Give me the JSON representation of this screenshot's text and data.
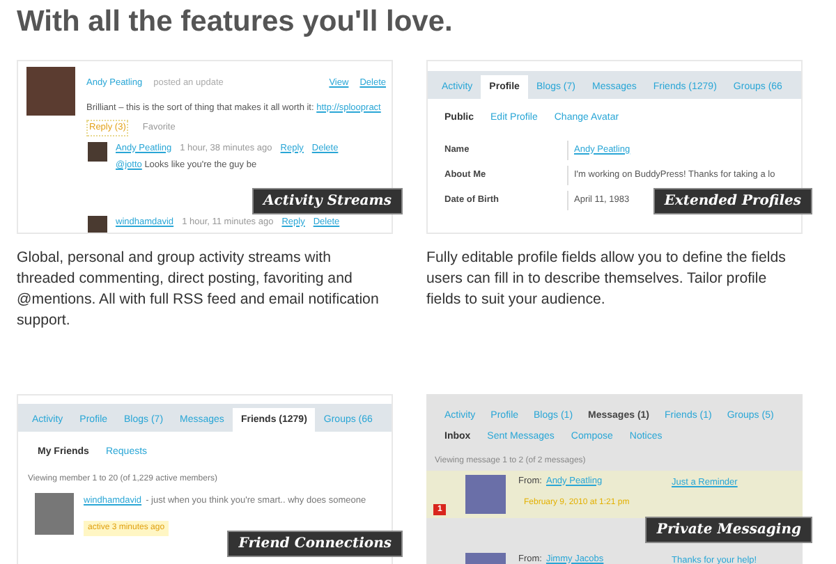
{
  "heading": "With all the features you'll love.",
  "features": [
    {
      "kind": "activity",
      "caption": "Activity Streams",
      "description": "Global, personal and group activity streams with threaded commenting, direct posting, favoriting and @mentions. All with full RSS feed and email notification support.",
      "screen": {
        "author": "Andy Peatling",
        "action": "posted an update",
        "links": [
          "View",
          "Delete"
        ],
        "text": "Brilliant – this is the sort of thing that makes it all worth it:",
        "url": "http://sploopract",
        "reply": "Reply (3)",
        "favorite": "Favorite",
        "comments": [
          {
            "author": "Andy Peatling",
            "time": "1 hour, 38 minutes ago",
            "links": [
              "Reply",
              "Delete"
            ],
            "mention": "@jotto",
            "text": "Looks like you're the guy be"
          },
          {
            "author": "windhamdavid",
            "time": "1 hour, 11 minutes ago",
            "links": [
              "Reply",
              "Delete"
            ]
          }
        ]
      }
    },
    {
      "kind": "profile",
      "caption": "Extended Profiles",
      "description": "Fully editable profile fields allow you to define the fields users can fill in to describe themselves. Tailor profile fields to suit your audience.",
      "screen": {
        "tabs": [
          {
            "label": "Activity",
            "selected": false
          },
          {
            "label": "Profile",
            "selected": true
          },
          {
            "label": "Blogs (7)",
            "selected": false
          },
          {
            "label": "Messages",
            "selected": false
          },
          {
            "label": "Friends (1279)",
            "selected": false
          },
          {
            "label": "Groups (66",
            "selected": false
          }
        ],
        "subtabs": [
          {
            "label": "Public",
            "selected": true
          },
          {
            "label": "Edit Profile",
            "selected": false
          },
          {
            "label": "Change Avatar",
            "selected": false
          }
        ],
        "fields": [
          {
            "label": "Name",
            "value": "Andy Peatling",
            "linked": true
          },
          {
            "label": "About Me",
            "value": "I'm working on BuddyPress! Thanks for taking a lo",
            "linked": false
          },
          {
            "label": "Date of Birth",
            "value": "April 11, 1983",
            "linked": false
          }
        ]
      }
    },
    {
      "kind": "friends",
      "caption": "Friend Connections",
      "screen": {
        "tabs": [
          {
            "label": "Activity",
            "selected": false
          },
          {
            "label": "Profile",
            "selected": false
          },
          {
            "label": "Blogs (7)",
            "selected": false
          },
          {
            "label": "Messages",
            "selected": false
          },
          {
            "label": "Friends (1279)",
            "selected": true
          },
          {
            "label": "Groups (66",
            "selected": false
          }
        ],
        "subtabs": [
          {
            "label": "My Friends",
            "selected": true
          },
          {
            "label": "Requests",
            "selected": false
          }
        ],
        "count": "Viewing member 1 to 20 (of 1,229 active members)",
        "member": {
          "name": "windhamdavid",
          "excerpt": "- just when you think you're smart.. why does someone",
          "activity": "active 3 minutes ago"
        }
      }
    },
    {
      "kind": "messages",
      "caption": "Private Messaging",
      "screen": {
        "tabs": [
          {
            "label": "Activity",
            "selected": false
          },
          {
            "label": "Profile",
            "selected": false
          },
          {
            "label": "Blogs (1)",
            "selected": false
          },
          {
            "label": "Messages (1)",
            "selected": true
          },
          {
            "label": "Friends (1)",
            "selected": false
          },
          {
            "label": "Groups (5)",
            "selected": false
          }
        ],
        "subtabs": [
          {
            "label": "Inbox",
            "selected": true
          },
          {
            "label": "Sent Messages",
            "selected": false
          },
          {
            "label": "Compose",
            "selected": false
          },
          {
            "label": "Notices",
            "selected": false
          }
        ],
        "count": "Viewing message 1 to 2 (of 2 messages)",
        "messages": [
          {
            "unread": true,
            "badge": "1",
            "from_label": "From:",
            "sender": "Andy Peatling",
            "date": "February 9, 2010 at 1:21 pm",
            "subject": "Just a Reminder"
          },
          {
            "unread": false,
            "from_label": "From:",
            "sender": "Jimmy Jacobs",
            "subject": "Thanks for your help!"
          }
        ]
      }
    }
  ]
}
